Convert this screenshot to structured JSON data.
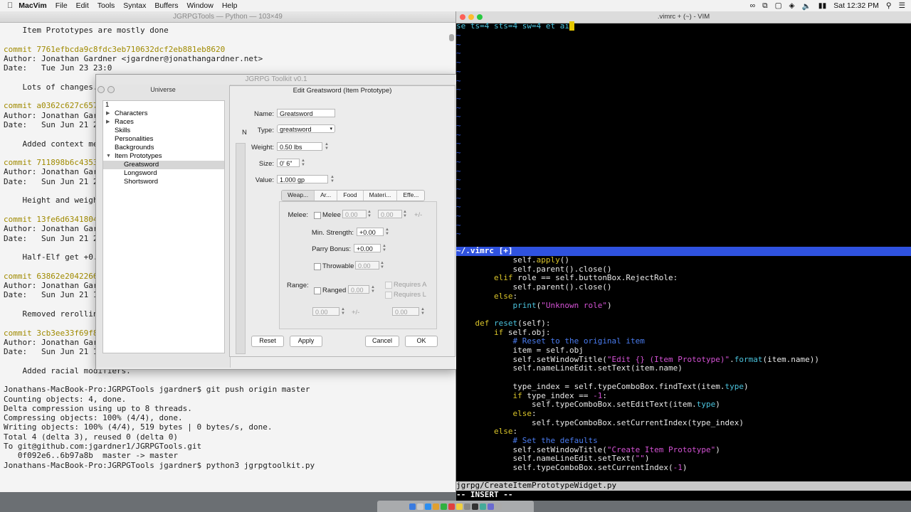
{
  "menubar": {
    "apple": "",
    "app_name": "MacVim",
    "items": [
      "File",
      "Edit",
      "Tools",
      "Syntax",
      "Buffers",
      "Window",
      "Help"
    ],
    "clock": "Sat 12:32 PM"
  },
  "terminal": {
    "title": "JGRPGTools — Python — 103×49",
    "lines": [
      {
        "t": "    Item Prototypes are mostly done",
        "c": ""
      },
      {
        "t": "",
        "c": ""
      },
      {
        "t": "commit 7761efbcda9c8fdc3eb710632dcf2eb881eb8620",
        "c": "y"
      },
      {
        "t": "Author: Jonathan Gardner <jgardner@jonathangardner.net>",
        "c": ""
      },
      {
        "t": "Date:   Tue Jun 23 23:0",
        "c": ""
      },
      {
        "t": "",
        "c": ""
      },
      {
        "t": "    Lots of changes.",
        "c": ""
      },
      {
        "t": "",
        "c": ""
      },
      {
        "t": "commit a0362c627c657f",
        "c": "y"
      },
      {
        "t": "Author: Jonathan Gardn",
        "c": ""
      },
      {
        "t": "Date:   Sun Jun 21 22:",
        "c": ""
      },
      {
        "t": "",
        "c": ""
      },
      {
        "t": "    Added context menu",
        "c": ""
      },
      {
        "t": "",
        "c": ""
      },
      {
        "t": "commit 711898b6c4353c",
        "c": "y"
      },
      {
        "t": "Author: Jonathan Gardn",
        "c": ""
      },
      {
        "t": "Date:   Sun Jun 21 21:",
        "c": ""
      },
      {
        "t": "",
        "c": ""
      },
      {
        "t": "    Height and weight",
        "c": ""
      },
      {
        "t": "",
        "c": ""
      },
      {
        "t": "commit 13fe6d634180490",
        "c": "y"
      },
      {
        "t": "Author: Jonathan Gardn",
        "c": ""
      },
      {
        "t": "Date:   Sun Jun 21 21:",
        "c": ""
      },
      {
        "t": "",
        "c": ""
      },
      {
        "t": "    Half-Elf get +0.3",
        "c": ""
      },
      {
        "t": "",
        "c": ""
      },
      {
        "t": "commit 63862e2042266c",
        "c": "y"
      },
      {
        "t": "Author: Jonathan Gardn",
        "c": ""
      },
      {
        "t": "Date:   Sun Jun 21 14:",
        "c": ""
      },
      {
        "t": "",
        "c": ""
      },
      {
        "t": "    Removed rerolling",
        "c": ""
      },
      {
        "t": "",
        "c": ""
      },
      {
        "t": "commit 3cb3ee33f69f89",
        "c": "y"
      },
      {
        "t": "Author: Jonathan Gardn",
        "c": ""
      },
      {
        "t": "Date:   Sun Jun 21 14:",
        "c": ""
      },
      {
        "t": "",
        "c": ""
      },
      {
        "t": "    Added racial modifiers.",
        "c": ""
      },
      {
        "t": "",
        "c": ""
      },
      {
        "t": "Jonathans-MacBook-Pro:JGRPGTools jgardner$ git push origin master",
        "c": ""
      },
      {
        "t": "Counting objects: 4, done.",
        "c": ""
      },
      {
        "t": "Delta compression using up to 8 threads.",
        "c": ""
      },
      {
        "t": "Compressing objects: 100% (4/4), done.",
        "c": ""
      },
      {
        "t": "Writing objects: 100% (4/4), 519 bytes | 0 bytes/s, done.",
        "c": ""
      },
      {
        "t": "Total 4 (delta 3), reused 0 (delta 0)",
        "c": ""
      },
      {
        "t": "To git@github.com:jgardner1/JGRPGTools.git",
        "c": ""
      },
      {
        "t": "   0f092e6..6b97a8b  master -> master",
        "c": ""
      },
      {
        "t": "Jonathans-MacBook-Pro:JGRPGTools jgardner$ python3 jgrpgtoolkit.py",
        "c": ""
      }
    ]
  },
  "toolkit": {
    "title": "JGRPG Toolkit v0.1",
    "universe_label": "Universe",
    "tree": [
      {
        "label": "1",
        "level": 0,
        "arrow": "",
        "sel": false
      },
      {
        "label": "Characters",
        "level": 1,
        "arrow": "▶",
        "sel": false
      },
      {
        "label": "Races",
        "level": 1,
        "arrow": "▶",
        "sel": false
      },
      {
        "label": "Skills",
        "level": 1,
        "arrow": "",
        "sel": false
      },
      {
        "label": "Personalities",
        "level": 1,
        "arrow": "",
        "sel": false
      },
      {
        "label": "Backgrounds",
        "level": 1,
        "arrow": "",
        "sel": false
      },
      {
        "label": "Item Prototypes",
        "level": 1,
        "arrow": "▼",
        "sel": false
      },
      {
        "label": "Greatsword",
        "level": 2,
        "arrow": "",
        "sel": true
      },
      {
        "label": "Longsword",
        "level": 2,
        "arrow": "",
        "sel": false
      },
      {
        "label": "Shortsword",
        "level": 2,
        "arrow": "",
        "sel": false
      }
    ]
  },
  "dialog": {
    "title": "Edit Greatsword (Item Prototype)",
    "side_label": "N",
    "name_label": "Name:",
    "name_value": "Greatsword",
    "type_label": "Type:",
    "type_value": "greatsword",
    "weight_label": "Weight:",
    "weight_value": "0.50 lbs",
    "size_label": "Size:",
    "size_value": "0' 6\"",
    "value_label": "Value:",
    "value_value": "1.000 gp",
    "tabs": [
      "Weap...",
      "Ar...",
      "Food",
      "Materi...",
      "Effe..."
    ],
    "melee_label": "Melee:",
    "melee_check": "Melee",
    "melee_a": "0.00",
    "melee_b": "0.00",
    "plusminus": "+/-",
    "min_strength_label": "Min. Strength:",
    "min_strength_value": "+0.00",
    "parry_label": "Parry Bonus:",
    "parry_value": "+0.00",
    "throwable_check": "Throwable",
    "throwable_value": "0.00",
    "range_label": "Range:",
    "ranged_check": "Ranged",
    "ranged_value": "0.00",
    "requires_a": "Requires A",
    "requires_l": "Requires L",
    "range_a": "0.00",
    "range_b": "0.00",
    "reset": "Reset",
    "apply": "Apply",
    "cancel": "Cancel",
    "ok": "OK"
  },
  "vim": {
    "title": ".vimrc + (~) - VIM",
    "top_line": "se ts=4 sts=4 sw=4 et ai",
    "top_status": "~/.vimrc [+]",
    "bottom_status": "jgrpg/CreateItemPrototypeWidget.py",
    "mode": "-- INSERT --",
    "code": [
      [
        [
          "            self.",
          ""
        ],
        [
          "apply",
          "y"
        ],
        [
          "()",
          ""
        ]
      ],
      [
        [
          "            self.parent().close()",
          ""
        ]
      ],
      [
        [
          "        ",
          ""
        ],
        [
          "elif",
          "y"
        ],
        [
          " role == self.buttonBox.RejectRole:",
          ""
        ]
      ],
      [
        [
          "            self.parent().close()",
          ""
        ]
      ],
      [
        [
          "        ",
          ""
        ],
        [
          "else",
          "y"
        ],
        [
          ":",
          ""
        ]
      ],
      [
        [
          "            ",
          ""
        ],
        [
          "print",
          "c"
        ],
        [
          "(",
          ""
        ],
        [
          "\"Unknown role\"",
          "s"
        ],
        [
          ")",
          ""
        ]
      ],
      [
        [
          "",
          ""
        ]
      ],
      [
        [
          "    ",
          ""
        ],
        [
          "def",
          "y"
        ],
        [
          " ",
          ""
        ],
        [
          "reset",
          "c"
        ],
        [
          "(self):",
          ""
        ]
      ],
      [
        [
          "        ",
          ""
        ],
        [
          "if",
          "y"
        ],
        [
          " self.obj:",
          ""
        ]
      ],
      [
        [
          "            ",
          ""
        ],
        [
          "# Reset to the original item",
          "m"
        ]
      ],
      [
        [
          "            item = self.obj",
          ""
        ]
      ],
      [
        [
          "            self.setWindowTitle(",
          ""
        ],
        [
          "\"Edit {} (Item Prototype)\"",
          "s"
        ],
        [
          ".",
          ""
        ],
        [
          "format",
          "c"
        ],
        [
          "(item.name))",
          ""
        ]
      ],
      [
        [
          "            self.nameLineEdit.setText(item.name)",
          ""
        ]
      ],
      [
        [
          "",
          ""
        ]
      ],
      [
        [
          "            type_index = self.typeComboBox.findText(item.",
          ""
        ],
        [
          "type",
          "c"
        ],
        [
          ")",
          ""
        ]
      ],
      [
        [
          "            ",
          ""
        ],
        [
          "if",
          "y"
        ],
        [
          " type_index == ",
          ""
        ],
        [
          "-1",
          "s"
        ],
        [
          ":",
          ""
        ]
      ],
      [
        [
          "                self.typeComboBox.setEditText(item.",
          ""
        ],
        [
          "type",
          "c"
        ],
        [
          ")",
          ""
        ]
      ],
      [
        [
          "            ",
          ""
        ],
        [
          "else",
          "y"
        ],
        [
          ":",
          ""
        ]
      ],
      [
        [
          "                self.typeComboBox.setCurrentIndex(type_index)",
          ""
        ]
      ],
      [
        [
          "        ",
          ""
        ],
        [
          "else",
          "y"
        ],
        [
          ":",
          ""
        ]
      ],
      [
        [
          "            ",
          ""
        ],
        [
          "# Set the defaults",
          "m"
        ]
      ],
      [
        [
          "            self.setWindowTitle(",
          ""
        ],
        [
          "\"Create Item Prototype\"",
          "s"
        ],
        [
          ")",
          ""
        ]
      ],
      [
        [
          "            self.nameLineEdit.setText(",
          ""
        ],
        [
          "\"\"",
          "s"
        ],
        [
          ")",
          ""
        ]
      ],
      [
        [
          "            self.typeComboBox.setCurrentIndex(",
          ""
        ],
        [
          "-1",
          "s"
        ],
        [
          ")",
          ""
        ]
      ]
    ]
  }
}
